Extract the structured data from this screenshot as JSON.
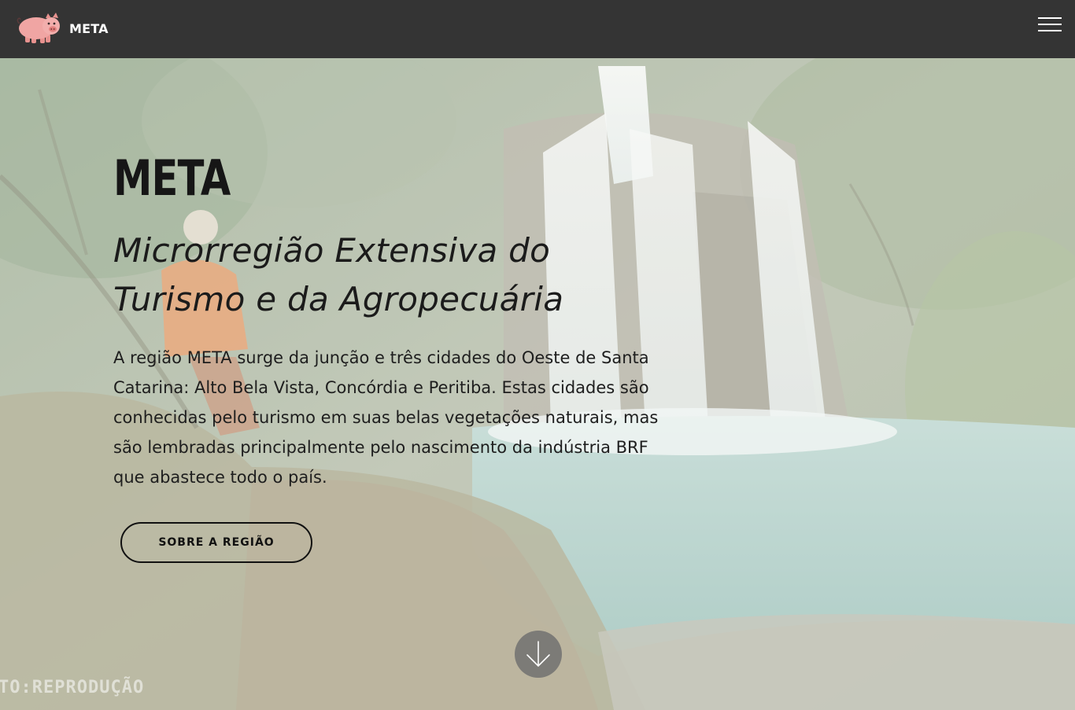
{
  "navbar": {
    "brand": "META",
    "logo_icon": "pig-icon",
    "menu_icon": "hamburger-menu-icon"
  },
  "hero": {
    "title": "META",
    "subtitle_line1": "Microrregião Extensiva do",
    "subtitle_line2": "Turismo e da Agropecuária",
    "description": "A região META surge da junção e três cidades do Oeste de Santa Catarina: Alto Bela Vista, Concórdia e Peritiba. Estas cidades são conhecidas pelo turismo em suas belas vegetações naturais, mas são lembradas principalmente pelo nascimento da indústria BRF que abastece todo o país.",
    "button_label": "SOBRE A REGIÃO",
    "scroll_icon": "arrow-down-icon",
    "photo_credit": "TO:REPRODUÇÃO"
  },
  "colors": {
    "navbar_bg": "#343434",
    "pig": "#f0a5a3",
    "text": "#1b1b1b",
    "water": "#9fc0b8"
  }
}
